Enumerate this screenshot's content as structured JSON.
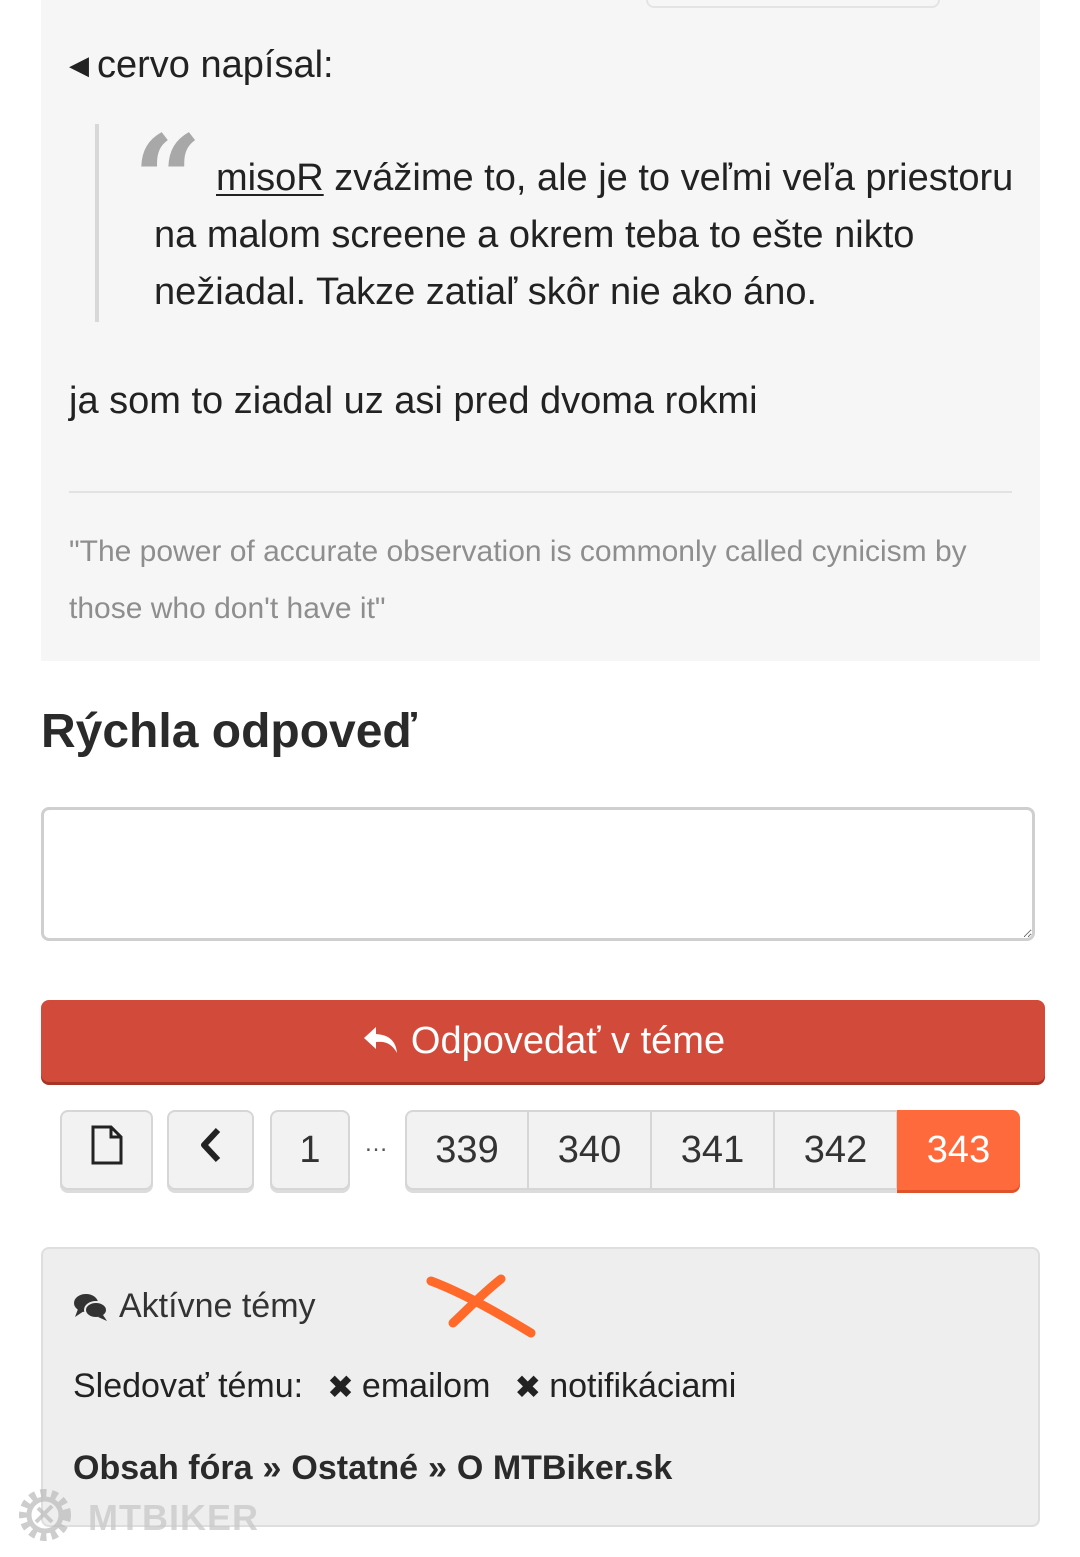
{
  "quote": {
    "author_line": "cervo napísal:",
    "mention": "misoR",
    "text": " zvážime to, ale je to veľmi veľa priestoru na malom screene a okrem teba to ešte nikto nežiadal. Takze zatiaľ skôr nie ako áno."
  },
  "post": {
    "body": "ja som to ziadal uz asi pred dvoma rokmi",
    "signature": "\"The power of accurate observation is commonly called cynicism by those who don't have it\""
  },
  "quick_reply": {
    "title": "Rýchla odpoveď",
    "textarea_value": "",
    "button_label": "Odpovedať v téme"
  },
  "pagination": {
    "first_page": "1",
    "ellipsis": "…",
    "pages": [
      "339",
      "340",
      "341",
      "342",
      "343"
    ],
    "current": "343",
    "accent_color": "#ff6a3d"
  },
  "footer_panel": {
    "active_topics": "Aktívne témy",
    "follow_label": "Sledovať tému:",
    "follow_options": [
      "emailom",
      "notifikáciami"
    ],
    "breadcrumb": [
      "Obsah fóra",
      "Ostatné",
      "O MTBiker.sk"
    ],
    "breadcrumb_sep": "»"
  },
  "watermark": "MTBIKER",
  "colors": {
    "reply_button": "#d24a39",
    "annotation_scribble": "#ff6a2a"
  }
}
